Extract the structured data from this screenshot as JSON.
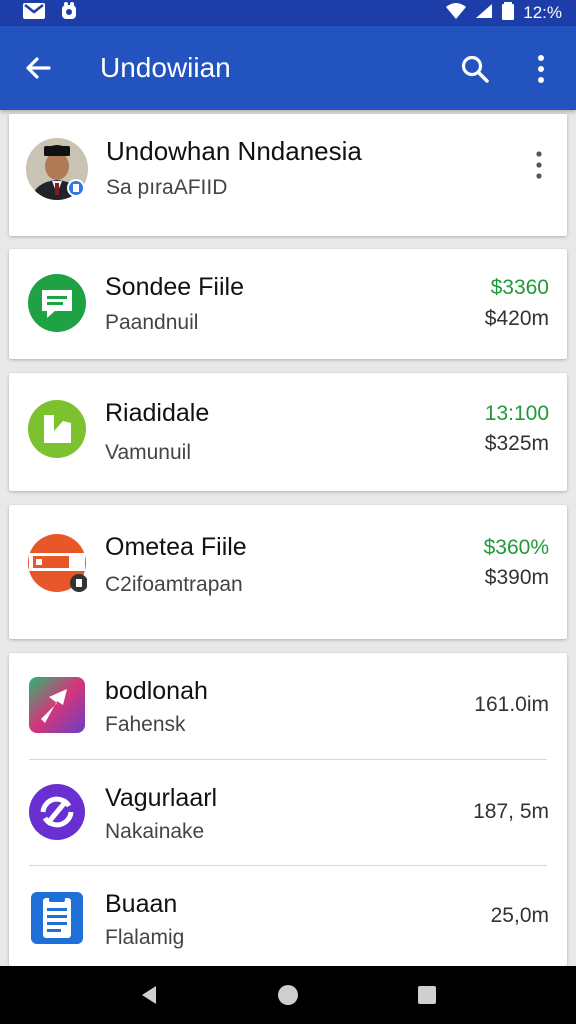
{
  "status_bar": {
    "left_icons": [
      "mail-icon",
      "notification-app-icon"
    ],
    "time": "12:%",
    "right_icons": [
      "wifi-icon",
      "signal-icon",
      "battery-icon"
    ]
  },
  "app_bar": {
    "title": "Undowiian",
    "background": "#2353bf"
  },
  "profile": {
    "name": "Undowhan Nndanesia",
    "subtitle": "Sa pıraAFIID"
  },
  "items": [
    {
      "name": "Sondee Fiile",
      "subtitle": "Paandnuil",
      "value_top": "$3360",
      "value_bottom": "$420m",
      "icon": "chat-bubble-icon",
      "icon_color": "#1ea243"
    },
    {
      "name": "Riadidale",
      "subtitle": "Vamunuil",
      "value_top": "13:100",
      "value_bottom": "$325m",
      "icon": "lime-app-icon",
      "icon_color": "#7cc22f"
    },
    {
      "name": "Ometea Fiile",
      "subtitle": "C2ifoamtrapan",
      "value_top": "$360%",
      "value_bottom": "$390m",
      "icon": "orange-app-icon",
      "icon_color": "#e8572a"
    }
  ],
  "list_items": [
    {
      "name": "bodlonah",
      "subtitle": "Fahensk",
      "value": "161.0im",
      "icon": "gradient-app-icon"
    },
    {
      "name": "Vagurlaarl",
      "subtitle": "Nakainake",
      "value": "187, 5m",
      "icon": "purple-app-icon"
    },
    {
      "name": "Buaan",
      "subtitle": "Flalamig",
      "value": "25,0m",
      "icon": "document-app-icon"
    }
  ],
  "colors": {
    "positive": "#1f9a3a",
    "appbar": "#2353bf",
    "statusbar": "#1d3ea8"
  }
}
